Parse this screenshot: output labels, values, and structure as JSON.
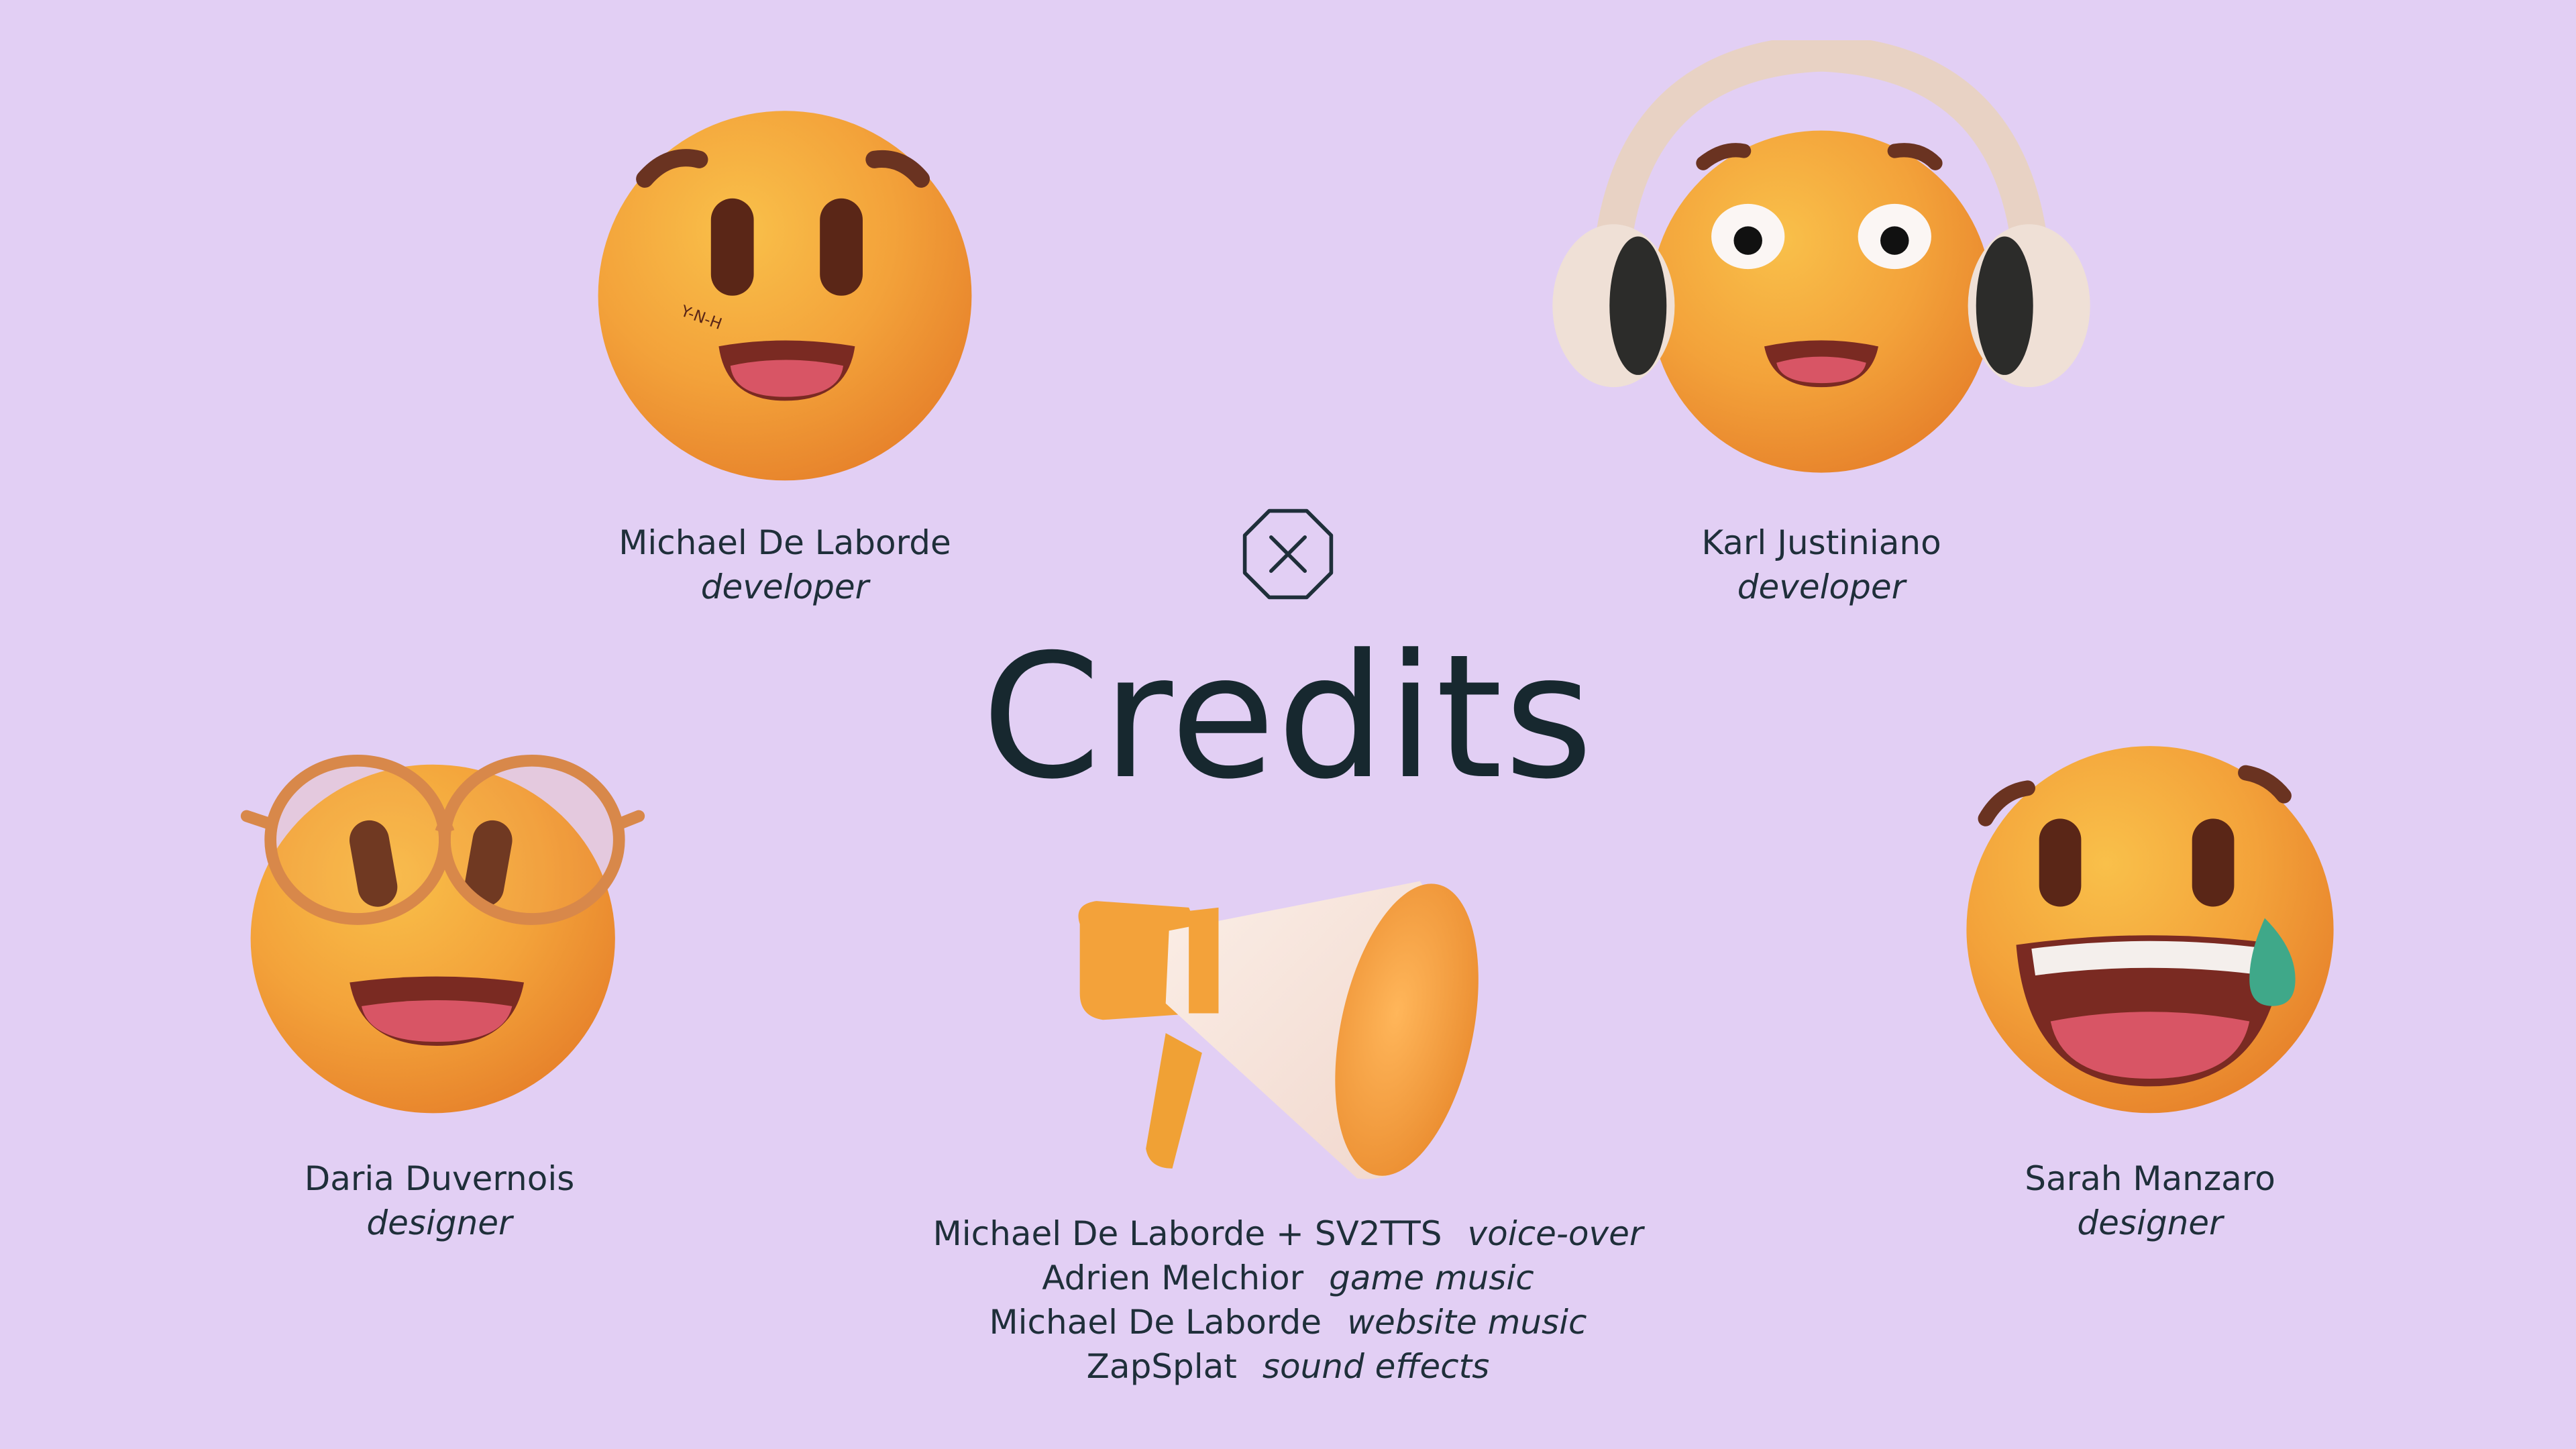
{
  "title": "Credits",
  "icons": {
    "close": "close-octagon-icon",
    "megaphone": "megaphone-icon"
  },
  "colors": {
    "background": "#e2cff4",
    "text": "#1f2f3a",
    "emoji": "#f0a135"
  },
  "team": [
    {
      "name": "Michael De Laborde",
      "role": "developer"
    },
    {
      "name": "Karl Justiniano",
      "role": "developer"
    },
    {
      "name": "Daria Duvernois",
      "role": "designer"
    },
    {
      "name": "Sarah Manzaro",
      "role": "designer"
    }
  ],
  "audio_credits": [
    {
      "who": "Michael De Laborde + SV2TTS",
      "what": "voice-over"
    },
    {
      "who": "Adrien Melchior",
      "what": "game music"
    },
    {
      "who": "Michael De Laborde",
      "what": "website music"
    },
    {
      "who": "ZapSplat",
      "what": "sound effects"
    }
  ]
}
